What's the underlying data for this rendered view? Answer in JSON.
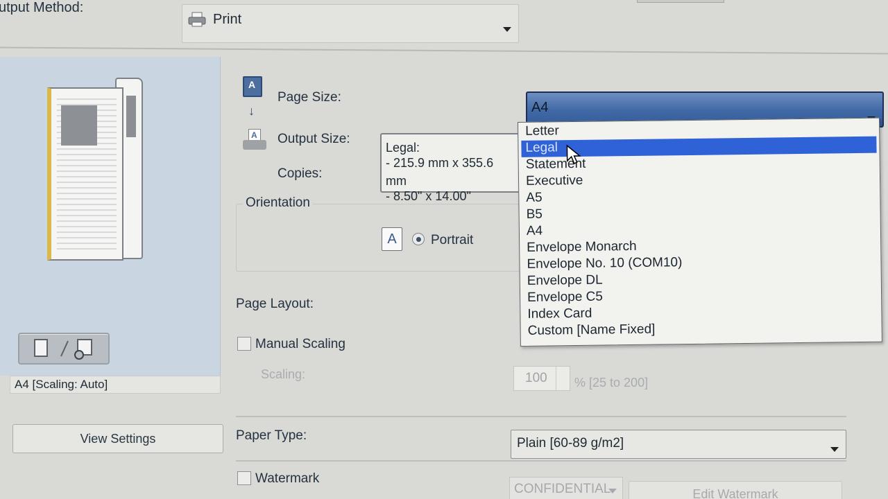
{
  "output_method": {
    "label": "utput Method:",
    "value": "Print",
    "icon": "printer-icon"
  },
  "preview": {
    "caption": "A4 [Scaling: Auto]",
    "view_settings_label": "View Settings"
  },
  "page_size": {
    "label": "Page Size:",
    "value": "A4",
    "icon": "page-size-icon"
  },
  "output_size": {
    "label": "Output Size:",
    "icon": "output-tray-icon"
  },
  "copies": {
    "label": "Copies:"
  },
  "tooltip": {
    "title": "Legal:",
    "line1": "- 215.9 mm x 355.6 mm",
    "line2": "- 8.50\" x 14.00\""
  },
  "page_size_options": [
    "Letter",
    "Legal",
    "Statement",
    "Executive",
    "A5",
    "B5",
    "A4",
    "Envelope Monarch",
    "Envelope No. 10 (COM10)",
    "Envelope DL",
    "Envelope C5",
    "Index Card",
    "Custom [Name Fixed]"
  ],
  "highlighted_option": "Legal",
  "orientation": {
    "title": "Orientation",
    "portrait_label": "Portrait",
    "portrait_icon": "A"
  },
  "page_layout": {
    "label": "Page Layout:"
  },
  "manual_scaling": {
    "label": "Manual Scaling",
    "checked": false
  },
  "scaling": {
    "label": "Scaling:",
    "value": "100",
    "range": "% [25 to 200]"
  },
  "paper_type": {
    "label": "Paper Type:",
    "value": "Plain [60-89 g/m2]"
  },
  "watermark": {
    "label": "Watermark",
    "checked": false,
    "value": "CONFIDENTIAL",
    "edit_label": "Edit Watermark"
  },
  "colors": {
    "accent": "#2f62d6",
    "select_blue": "#3f68a6",
    "panel_bg": "#c9d6e2",
    "window_bg": "#d9d9d6"
  }
}
